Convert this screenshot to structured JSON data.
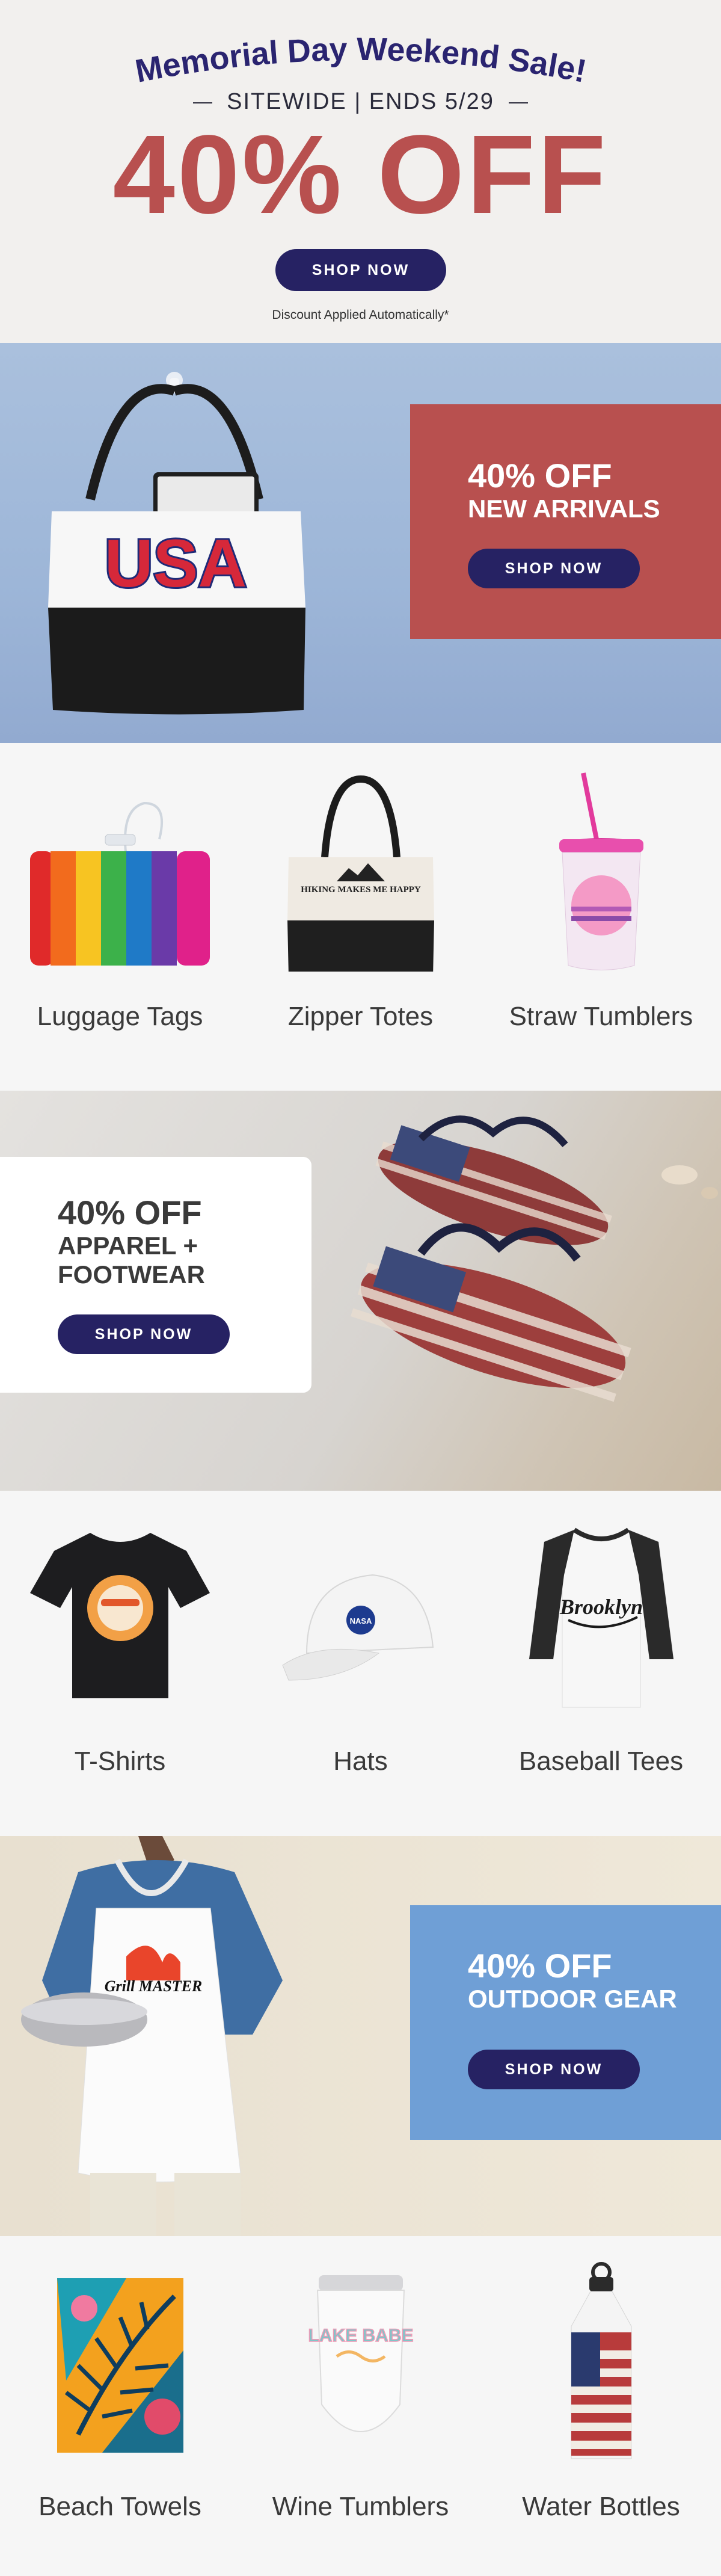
{
  "hero": {
    "headline": "Memorial Day Weekend Sale!",
    "subline": "SITEWIDE | ENDS 5/29",
    "discount": "40% OFF",
    "button": "SHOP NOW",
    "note": "Discount Applied Automatically*"
  },
  "colors": {
    "navy": "#262263",
    "red": "#b8504f",
    "blue": "#6f9fd6",
    "headline": "#2a2470"
  },
  "banners": [
    {
      "line1": "40% OFF",
      "line2": "NEW ARRIVALS",
      "button": "SHOP NOW",
      "image_text": "USA"
    },
    {
      "line1": "40% OFF",
      "line2a": "APPAREL +",
      "line2b": "FOOTWEAR",
      "button": "SHOP NOW"
    },
    {
      "line1": "40% OFF",
      "line2": "OUTDOOR GEAR",
      "button": "SHOP NOW",
      "image_text": "Grill MASTER"
    }
  ],
  "products": {
    "row1": [
      {
        "label": "Luggage Tags",
        "icon": "rainbow-luggage-tag"
      },
      {
        "label": "Zipper Totes",
        "icon": "tote-bag",
        "image_text": "HIKING MAKES ME HAPPY"
      },
      {
        "label": "Straw Tumblers",
        "icon": "straw-tumbler"
      }
    ],
    "row2": [
      {
        "label": "T-Shirts",
        "icon": "tshirt"
      },
      {
        "label": "Hats",
        "icon": "cap",
        "image_text": "NASA"
      },
      {
        "label": "Baseball Tees",
        "icon": "raglan-tee",
        "image_text": "Brooklyn"
      }
    ],
    "row3": [
      {
        "label": "Beach Towels",
        "icon": "tropical-towel"
      },
      {
        "label": "Wine Tumblers",
        "icon": "wine-tumbler",
        "image_text": "LAKE BABE"
      },
      {
        "label": "Water Bottles",
        "icon": "flag-water-bottle"
      }
    ]
  }
}
